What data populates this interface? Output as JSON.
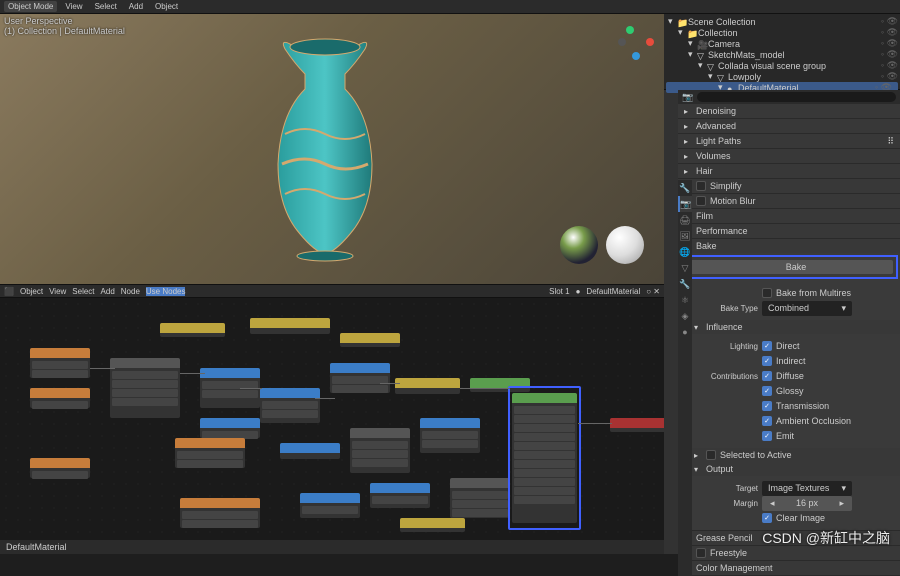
{
  "top": {
    "mode": "Object Mode",
    "menus": [
      "View",
      "Select",
      "Add",
      "Object"
    ]
  },
  "viewport": {
    "persp": "User Perspective",
    "coll": "(1) Collection | DefaultMaterial"
  },
  "nodehdr": {
    "obj": "Object",
    "menus": [
      "View",
      "Select",
      "Add",
      "Node"
    ],
    "use": "Use Nodes",
    "slot": "Slot 1",
    "mat": "DefaultMaterial"
  },
  "outliner": {
    "rows": [
      {
        "label": "Scene Collection",
        "indent": 0,
        "sel": false,
        "ico": "📁"
      },
      {
        "label": "Collection",
        "indent": 1,
        "sel": false,
        "ico": "📁"
      },
      {
        "label": "Camera",
        "indent": 2,
        "sel": false,
        "ico": "🎥"
      },
      {
        "label": "SketchMats_model",
        "indent": 2,
        "sel": false,
        "ico": "▽"
      },
      {
        "label": "Collada visual scene group",
        "indent": 3,
        "sel": false,
        "ico": "▽"
      },
      {
        "label": "Lowpoly",
        "indent": 4,
        "sel": false,
        "ico": "▽"
      },
      {
        "label": "DefaultMaterial",
        "indent": 5,
        "sel": true,
        "ico": "●"
      }
    ]
  },
  "panels": {
    "denoising": "Denoising",
    "advanced": "Advanced",
    "lightpaths": "Light Paths",
    "volumes": "Volumes",
    "hair": "Hair",
    "simplify": "Simplify",
    "motionblur": "Motion Blur",
    "film": "Film",
    "performance": "Performance",
    "bake": "Bake",
    "greasepencil": "Grease Pencil",
    "freestyle": "Freestyle",
    "colormgmt": "Color Management"
  },
  "bake": {
    "button": "Bake",
    "multires": "Bake from Multires",
    "type_label": "Bake Type",
    "type_value": "Combined",
    "influence": "Influence",
    "lighting_label": "Lighting",
    "direct": "Direct",
    "indirect": "Indirect",
    "contrib_label": "Contributions",
    "diffuse": "Diffuse",
    "glossy": "Glossy",
    "transmission": "Transmission",
    "ao": "Ambient Occlusion",
    "emit": "Emit",
    "sel2active": "Selected to Active",
    "output": "Output",
    "target_label": "Target",
    "target_value": "Image Textures",
    "margin_label": "Margin",
    "margin_value": "16 px",
    "clear": "Clear Image"
  },
  "status": "DefaultMaterial",
  "watermark": "CSDN @新缸中之脑"
}
